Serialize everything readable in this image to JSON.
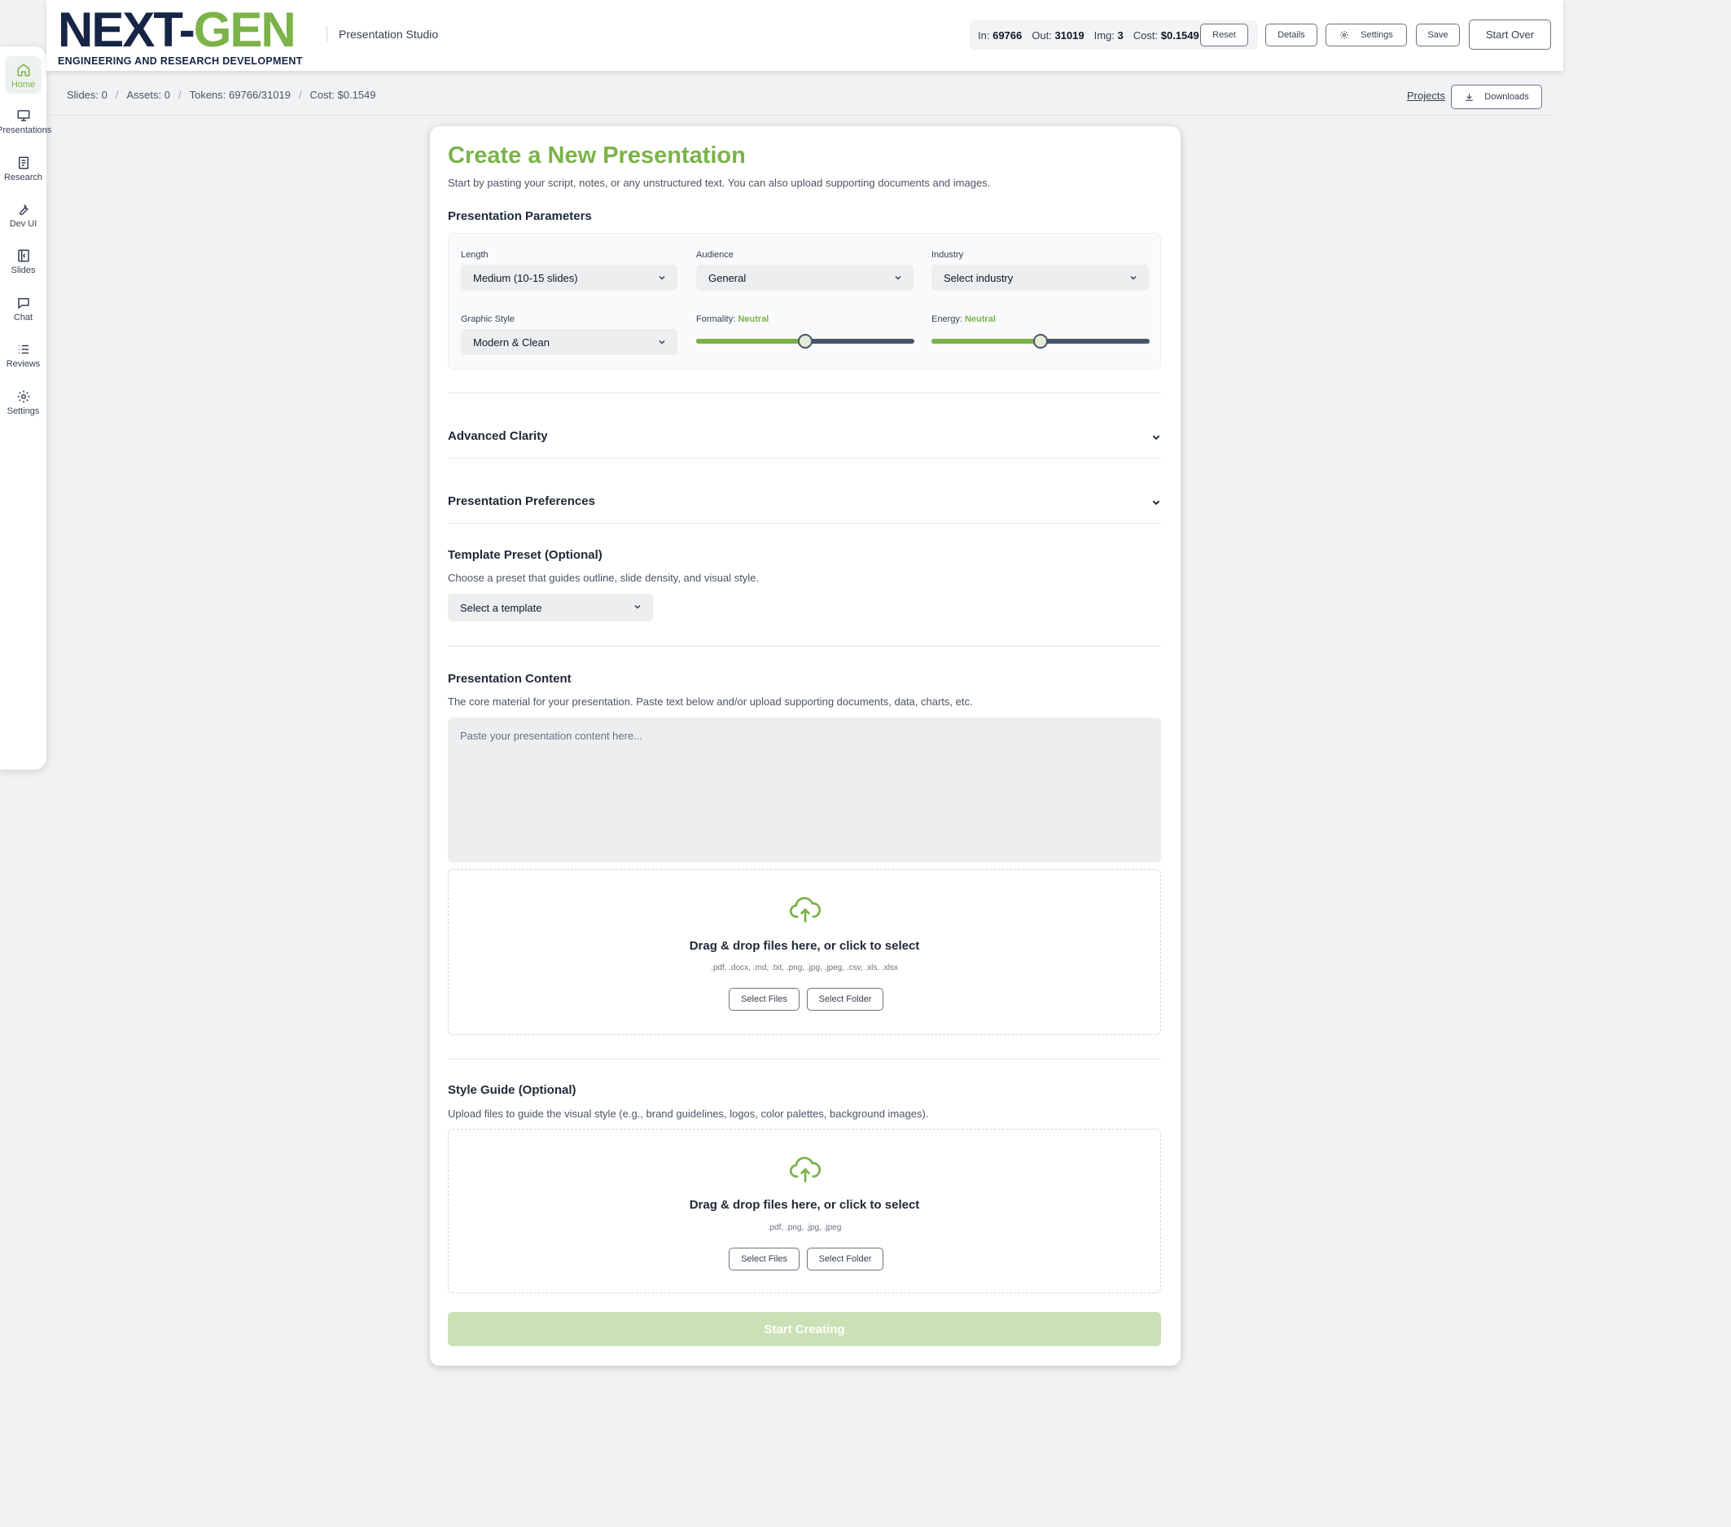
{
  "app": {
    "logo_main_dark": "NEXT-",
    "logo_main_green": "GEN",
    "logo_sub": "ENGINEERING AND RESEARCH DEVELOPMENT",
    "subtitle": "Presentation Studio"
  },
  "header": {
    "in_label": "In:",
    "in_value": "69766",
    "out_label": "Out:",
    "out_value": "31019",
    "img_label": "Img:",
    "img_value": "3",
    "cost_label": "Cost:",
    "cost_value": "$0.1549",
    "reset": "Reset",
    "details": "Details",
    "settings": "Settings",
    "save": "Save",
    "start_over": "Start Over"
  },
  "sidebar": {
    "items": [
      {
        "label": "Home",
        "icon": "home-icon"
      },
      {
        "label": "Presentations",
        "icon": "presentation-icon"
      },
      {
        "label": "Research",
        "icon": "document-icon"
      },
      {
        "label": "Dev UI",
        "icon": "wrench-icon"
      },
      {
        "label": "Slides",
        "icon": "slides-icon"
      },
      {
        "label": "Chat",
        "icon": "chat-icon"
      },
      {
        "label": "Reviews",
        "icon": "list-icon"
      },
      {
        "label": "Settings",
        "icon": "gear-icon"
      }
    ],
    "active": "Home"
  },
  "statsbar": {
    "slides": "Slides: 0",
    "assets": "Assets: 0",
    "tokens": "Tokens: 69766/31019",
    "cost": "Cost: $0.1549",
    "projects": "Projects",
    "downloads": "Downloads"
  },
  "main": {
    "title": "Create a New Presentation",
    "subtitle": "Start by pasting your script, notes, or any unstructured text. You can also upload supporting documents and images.",
    "params_heading": "Presentation Parameters",
    "length_label": "Length",
    "length_value": "Medium (10-15 slides)",
    "audience_label": "Audience",
    "audience_value": "General",
    "industry_label": "Industry",
    "industry_value": "Select industry",
    "graphic_label": "Graphic Style",
    "graphic_value": "Modern & Clean",
    "formality_label": "Formality:",
    "formality_value": "Neutral",
    "formality_level": 0.5,
    "energy_label": "Energy:",
    "energy_value": "Neutral",
    "energy_level": 0.5,
    "advanced_clarity": "Advanced Clarity",
    "presentation_preferences": "Presentation Preferences",
    "template_heading": "Template Preset (Optional)",
    "template_desc": "Choose a preset that guides outline, slide density, and visual style.",
    "template_value": "Select a template",
    "content_heading": "Presentation Content",
    "content_desc": "The core material for your presentation. Paste text below and/or upload supporting documents, data, charts, etc.",
    "content_placeholder": "Paste your presentation content here...",
    "dropzone1_title": "Drag & drop files here, or click to select",
    "dropzone1_types": ".pdf, .docx, .md, .txt, .png, .jpg, .jpeg, .csv, .xls, .xlsx",
    "select_files": "Select Files",
    "select_folder": "Select Folder",
    "style_heading": "Style Guide (Optional)",
    "style_desc": "Upload files to guide the visual style (e.g., brand guidelines, logos, color palettes, background images).",
    "dropzone2_title": "Drag & drop files here, or click to select",
    "dropzone2_types": ".pdf, .png, .jpg, .jpeg",
    "start_creating": "Start Creating"
  },
  "colors": {
    "accent": "#7bb34a",
    "navy": "#162446",
    "slider_track": "#475569",
    "disabled_button": "#c9e1b5"
  }
}
